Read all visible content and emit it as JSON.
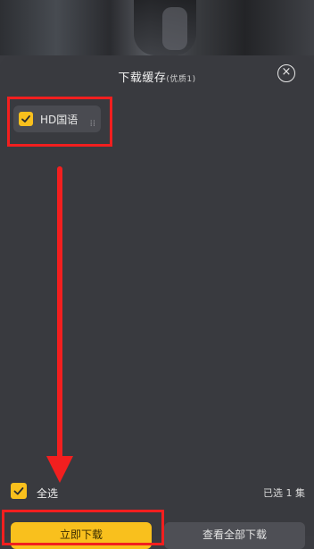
{
  "header": {
    "title": "下载缓存",
    "subtitle": "(优质1)"
  },
  "episodes": [
    {
      "label": "HD国语",
      "checked": true
    }
  ],
  "footer": {
    "select_all_label": "全选",
    "selected_count": "已选 1 集",
    "download_button": "立即下载",
    "view_all_button": "查看全部下载"
  },
  "colors": {
    "accent": "#f9c01d",
    "panel": "#393a3f",
    "annotation": "#f21f1f"
  }
}
